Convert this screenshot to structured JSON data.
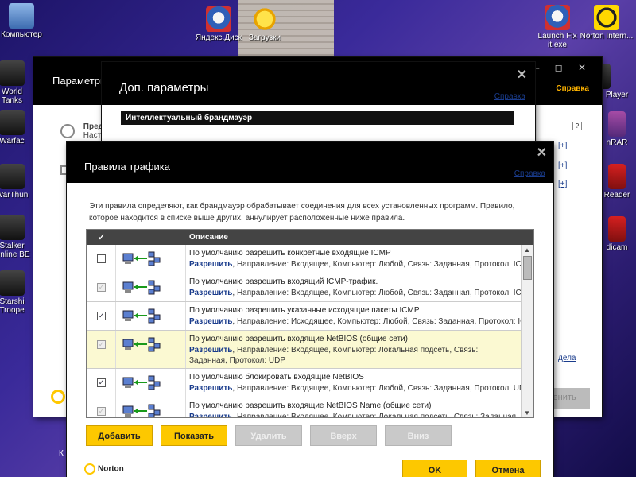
{
  "desktop": {
    "icons": [
      {
        "label": "Компьютер",
        "icon": "computer-icon"
      },
      {
        "label": "Яндекс.Диск",
        "icon": "yandex-disk-icon"
      },
      {
        "label": "Загрузки",
        "icon": "downloads-icon"
      },
      {
        "label": "Launch Fix it.exe",
        "icon": "fixit-icon"
      },
      {
        "label": "Norton Intern...",
        "icon": "norton-icon"
      },
      {
        "label": "World Tanks",
        "icon": "game-icon"
      },
      {
        "label": "Warfac",
        "icon": "game-icon"
      },
      {
        "label": "WarThun",
        "icon": "game-icon"
      },
      {
        "label": "Stalker Online BE",
        "icon": "game-icon"
      },
      {
        "label": "Starshi Troope",
        "icon": "game-icon"
      },
      {
        "label": "Player",
        "icon": "player-icon"
      },
      {
        "label": "nRAR",
        "icon": "winrar-icon"
      },
      {
        "label": "Reader",
        "icon": "reader-icon"
      },
      {
        "label": "dicam",
        "icon": "bandicam-icon"
      }
    ]
  },
  "params_window": {
    "title": "Параметры",
    "help": "Справка",
    "row1_title": "Пред",
    "row1_sub": "Наст",
    "links": [
      "[+]",
      "[+]",
      "[+]"
    ],
    "section_link": "дела",
    "right_button": "менить"
  },
  "dop_window": {
    "title": "Доп. параметры",
    "help": "Справка",
    "section": "Интеллектуальный брандмауэр"
  },
  "rules_window": {
    "title": "Правила трафика",
    "help": "Справка",
    "description": "Эти правила определяют, как брандмауэр обрабатывает соединения для всех установленных программ. Правило, которое находится в списке выше других, аннулирует расположенные ниже правила.",
    "table": {
      "header_check": "✓",
      "header_desc": "Описание",
      "rows": [
        {
          "checked": false,
          "enabled": true,
          "title": "По умолчанию разрешить конкретные входящие ICMP",
          "action": "Разрешить",
          "details": ", Направление: Входящее, Компьютер: Любой, Связь: Заданная, Протокол: ICMP"
        },
        {
          "checked": true,
          "enabled": false,
          "title": "По умолчанию разрешить входящий ICMP-трафик.",
          "action": "Разрешить",
          "details": ", Направление: Входящее, Компьютер: Любой, Связь: Заданная, Протокол: ICMP"
        },
        {
          "checked": true,
          "enabled": true,
          "title": "По умолчанию разрешить указанные исходящие пакеты ICMP",
          "action": "Разрешить",
          "details": ", Направление: Исходящее, Компьютер: Любой, Связь: Заданная, Протокол: ICMP"
        },
        {
          "checked": true,
          "enabled": false,
          "selected": true,
          "title": "По умолчанию разрешить входящие NetBIOS (общие сети)",
          "action": "Разрешить",
          "details": ", Направление: Входящее, Компьютер: Локальная подсеть, Связь: Заданная, Протокол: UDP"
        },
        {
          "checked": true,
          "enabled": true,
          "title": "По умолчанию блокировать входящие NetBIOS",
          "action": "Разрешить",
          "details": ", Направление: Входящее, Компьютер: Любой, Связь: Заданная, Протокол: UDP"
        },
        {
          "checked": true,
          "enabled": false,
          "title": "По умолчанию разрешить входящие NetBIOS Name (общие сети)",
          "action": "Разрешить",
          "details": ", Направление: Входящее, Компьютер: Локальная подсеть, Связь: Заданная,"
        }
      ]
    },
    "buttons": {
      "add": "Добавить",
      "show": "Показать",
      "delete": "Удалить",
      "up": "Вверх",
      "down": "Вниз",
      "ok": "OK",
      "cancel": "Отмена"
    },
    "brand": "Norton",
    "left_label": "К"
  },
  "colors": {
    "accent": "#fdc800",
    "link": "#1a3c8c",
    "header_bg": "#000000",
    "selected_row": "#fbf9d2"
  }
}
